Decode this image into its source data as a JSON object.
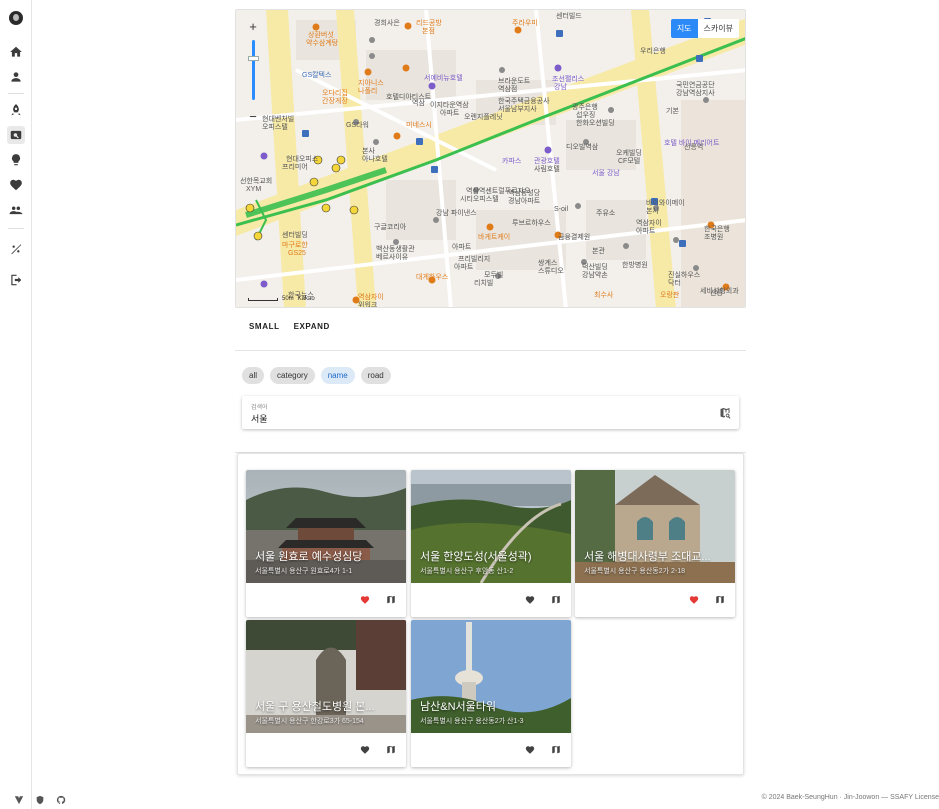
{
  "sidebar": {
    "items": [
      {
        "name": "home",
        "icon": "home-icon"
      },
      {
        "name": "profile",
        "icon": "person-icon"
      },
      {
        "name": "rocket",
        "icon": "rocket-icon"
      },
      {
        "name": "search",
        "icon": "image-search-icon",
        "active": true
      },
      {
        "name": "ideas",
        "icon": "lightbulb-icon"
      },
      {
        "name": "favorites",
        "icon": "heart-icon"
      },
      {
        "name": "groups",
        "icon": "group-icon"
      },
      {
        "name": "theme",
        "icon": "theme-toggle-icon"
      },
      {
        "name": "logout",
        "icon": "logout-icon"
      }
    ]
  },
  "map": {
    "type_buttons": [
      "지도",
      "스카이뷰"
    ],
    "active_type": "지도",
    "zoom_in": "+",
    "zoom_out": "−",
    "scale_text": "50m",
    "provider": "Kakao",
    "labels": [
      {
        "t": "경희사은",
        "c": ""
      },
      {
        "t": "상환버섯",
        "c": "orange"
      },
      {
        "t": "약수삼계탕",
        "c": "orange"
      },
      {
        "t": "리드공방",
        "c": "orange"
      },
      {
        "t": "본점",
        "c": "orange"
      },
      {
        "t": "주라우미",
        "c": "orange"
      },
      {
        "t": "센터빌드",
        "c": ""
      },
      {
        "t": "우리은행",
        "c": ""
      },
      {
        "t": "GS칼텍스",
        "c": "blue"
      },
      {
        "t": "지아니스",
        "c": "orange"
      },
      {
        "t": "나폴리",
        "c": "orange"
      },
      {
        "t": "오다리집",
        "c": "orange"
      },
      {
        "t": "간장게장",
        "c": "orange"
      },
      {
        "t": "서예비뉴호텔",
        "c": "purple"
      },
      {
        "t": "조선팰리스",
        "c": "purple"
      },
      {
        "t": "강남",
        "c": "purple"
      },
      {
        "t": "브라운도트",
        "c": ""
      },
      {
        "t": "역삼점",
        "c": ""
      },
      {
        "t": "국민연금공단",
        "c": ""
      },
      {
        "t": "강남역삼지사",
        "c": ""
      },
      {
        "t": "호텔디아티스트",
        "c": ""
      },
      {
        "t": "역삼",
        "c": ""
      },
      {
        "t": "이지타운역삼",
        "c": ""
      },
      {
        "t": "아파트",
        "c": ""
      },
      {
        "t": "한국주택금융공사",
        "c": ""
      },
      {
        "t": "서울남부지사",
        "c": ""
      },
      {
        "t": "현대벤처빌",
        "c": ""
      },
      {
        "t": "오피스텔",
        "c": ""
      },
      {
        "t": "GS타워",
        "c": ""
      },
      {
        "t": "미네스시",
        "c": "orange"
      },
      {
        "t": "오렌지플레닛",
        "c": ""
      },
      {
        "t": "광주은행",
        "c": ""
      },
      {
        "t": "섭우징",
        "c": ""
      },
      {
        "t": "한화오션빌딩",
        "c": ""
      },
      {
        "t": "선릉역",
        "c": ""
      },
      {
        "t": "현대오피스",
        "c": ""
      },
      {
        "t": "본사",
        "c": ""
      },
      {
        "t": "아나호텔",
        "c": ""
      },
      {
        "t": "카파스",
        "c": "purple"
      },
      {
        "t": "관광호텔",
        "c": "purple"
      },
      {
        "t": "사림호텔",
        "c": ""
      },
      {
        "t": "디오빌역삼",
        "c": ""
      },
      {
        "t": "오케빌딩",
        "c": ""
      },
      {
        "t": "CF모텔",
        "c": ""
      },
      {
        "t": "호텔 바이 메리어트",
        "c": "purple"
      },
      {
        "t": "서울 강남",
        "c": "purple"
      },
      {
        "t": "선한목교회",
        "c": ""
      },
      {
        "t": "XYM",
        "c": ""
      },
      {
        "t": "프리미어",
        "c": ""
      },
      {
        "t": "역삼역센트럴푸르지오",
        "c": ""
      },
      {
        "t": "시티오피스텔",
        "c": ""
      },
      {
        "t": "역삼동성당",
        "c": ""
      },
      {
        "t": "경남아파트",
        "c": ""
      },
      {
        "t": "S-oil",
        "c": ""
      },
      {
        "t": "주유소",
        "c": ""
      },
      {
        "t": "바이와이메이",
        "c": ""
      },
      {
        "t": "본사",
        "c": ""
      },
      {
        "t": "역삼자이",
        "c": ""
      },
      {
        "t": "아파트",
        "c": ""
      },
      {
        "t": "한국은행",
        "c": ""
      },
      {
        "t": "조병원",
        "c": ""
      },
      {
        "t": "구글코리아",
        "c": ""
      },
      {
        "t": "강남 파이낸스",
        "c": ""
      },
      {
        "t": "센터빌딩",
        "c": ""
      },
      {
        "t": "마구로한",
        "c": "orange"
      },
      {
        "t": "GS25",
        "c": "orange"
      },
      {
        "t": "바게트케이",
        "c": "orange"
      },
      {
        "t": "루브르하우스",
        "c": ""
      },
      {
        "t": "금융결제원",
        "c": ""
      },
      {
        "t": "본관",
        "c": ""
      },
      {
        "t": "백산동생활관",
        "c": ""
      },
      {
        "t": "베르사이유",
        "c": ""
      },
      {
        "t": "아파트",
        "c": ""
      },
      {
        "t": "프리빌리지",
        "c": ""
      },
      {
        "t": "아파트",
        "c": ""
      },
      {
        "t": "쌍계스",
        "c": ""
      },
      {
        "t": "스튜디오",
        "c": ""
      },
      {
        "t": "덕산빌딩",
        "c": ""
      },
      {
        "t": "강남약손",
        "c": ""
      },
      {
        "t": "한방병원",
        "c": ""
      },
      {
        "t": "진실하우스",
        "c": ""
      },
      {
        "t": "닥터",
        "c": ""
      },
      {
        "t": "세비성형외과",
        "c": ""
      },
      {
        "t": "모두빌",
        "c": ""
      },
      {
        "t": "리치빌",
        "c": ""
      },
      {
        "t": "오랑판",
        "c": "orange"
      },
      {
        "t": "최수사",
        "c": "orange"
      },
      {
        "t": "대게하우스",
        "c": "orange"
      },
      {
        "t": "역삼자이",
        "c": "orange"
      },
      {
        "t": "위워크",
        "c": ""
      },
      {
        "t": "선릉",
        "c": ""
      },
      {
        "t": "한국뉴스",
        "c": ""
      },
      {
        "t": "기본",
        "c": ""
      }
    ]
  },
  "controls": {
    "small": "SMALL",
    "expand": "EXPAND"
  },
  "filters": {
    "chips": [
      "all",
      "category",
      "name",
      "road"
    ],
    "active": "name"
  },
  "search": {
    "label": "검색어",
    "value": "서울",
    "icon": "map-search-icon"
  },
  "results": [
    {
      "title": "서울 원효로 예수성심당",
      "address": "서울특별시 용산구 원효로4가 1-1",
      "favorited": true,
      "photo": "palace"
    },
    {
      "title": "서울 한양도성(서울성곽)",
      "address": "서울특별시 용산구 후암동 산1-2",
      "favorited": false,
      "photo": "mountain"
    },
    {
      "title": "서울 해병대사령부 조대교...",
      "address": "서울특별시 용산구 용산동2가 2-18",
      "favorited": true,
      "photo": "church"
    },
    {
      "title": "서울 구 용산철도병원 본...",
      "address": "서울특별시 용산구 한강로3가 65-154",
      "favorited": false,
      "photo": "stone"
    },
    {
      "title": "남산&N서울타워",
      "address": "서울특별시 용산구 용산동2가 산1-3",
      "favorited": false,
      "photo": "tower"
    }
  ],
  "footer": {
    "icons": [
      "vuetify-icon",
      "shield-icon",
      "github-icon"
    ],
    "copyright": "© 2024 Baek-SeungHun · Jin-Joowon — SSAFY License"
  },
  "colors": {
    "favorite_active": "#e53935",
    "favorite_inactive": "#424242",
    "accent": "#2c8af8",
    "chip_active_bg": "#dce9f7"
  }
}
